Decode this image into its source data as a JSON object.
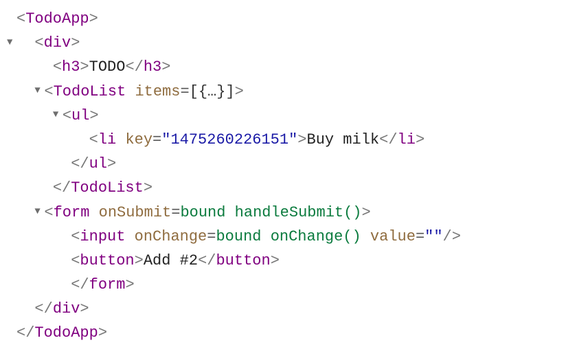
{
  "glyphs": {
    "angleOpen": "<",
    "angleClose": ">",
    "selfClose": "/>",
    "closeSlash": "</",
    "eq": "="
  },
  "tree": {
    "root": {
      "name": "TodoApp"
    },
    "div": {
      "name": "div"
    },
    "h3": {
      "name": "h3",
      "text": "TODO"
    },
    "todoList": {
      "name": "TodoList",
      "attr": {
        "name": "items",
        "expr": "[{…}]"
      }
    },
    "ul": {
      "name": "ul"
    },
    "li": {
      "name": "li",
      "key": {
        "name": "key",
        "value": "\"1475260226151\""
      },
      "text": "Buy milk"
    },
    "form": {
      "name": "form",
      "onSubmit": {
        "name": "onSubmit",
        "bound": "bound ",
        "func": "handleSubmit()"
      }
    },
    "input": {
      "name": "input",
      "onChange": {
        "name": "onChange",
        "bound": "bound ",
        "func": "onChange()"
      },
      "valueAttr": {
        "name": "value",
        "value": "\"\""
      }
    },
    "button": {
      "name": "button",
      "text": "Add #2"
    }
  },
  "indent": {
    "i0": "",
    "i1": "  ",
    "i2": "    ",
    "i3": "      ",
    "i4": "        "
  }
}
